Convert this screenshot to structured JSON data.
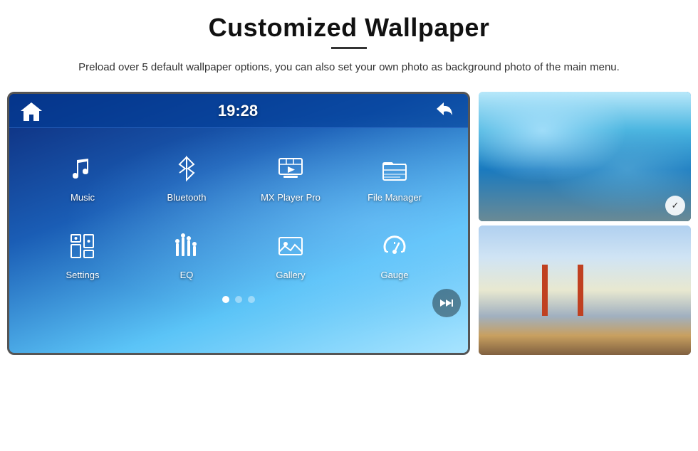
{
  "header": {
    "title": "Customized Wallpaper",
    "subtitle": "Preload over 5 default wallpaper options, you can also set your own photo as background photo of the main menu."
  },
  "car_screen": {
    "time": "19:28",
    "apps_row1": [
      {
        "id": "music",
        "label": "Music"
      },
      {
        "id": "bluetooth",
        "label": "Bluetooth"
      },
      {
        "id": "mxplayer",
        "label": "MX Player Pro"
      },
      {
        "id": "filemanager",
        "label": "File Manager"
      }
    ],
    "apps_row2": [
      {
        "id": "settings",
        "label": "Settings"
      },
      {
        "id": "eq",
        "label": "EQ"
      },
      {
        "id": "gallery",
        "label": "Gallery"
      },
      {
        "id": "gauge",
        "label": "Gauge"
      }
    ],
    "dots": [
      {
        "active": true
      },
      {
        "active": false
      },
      {
        "active": false
      }
    ]
  },
  "thumbnails": [
    {
      "id": "thumb-ice",
      "alt": "Ice cave wallpaper"
    },
    {
      "id": "thumb-bridge",
      "alt": "Golden Gate Bridge wallpaper"
    }
  ],
  "colors": {
    "accent": "#1a5db5",
    "screen_bg_start": "#0a1a4a",
    "screen_bg_end": "#7dd4f8"
  }
}
